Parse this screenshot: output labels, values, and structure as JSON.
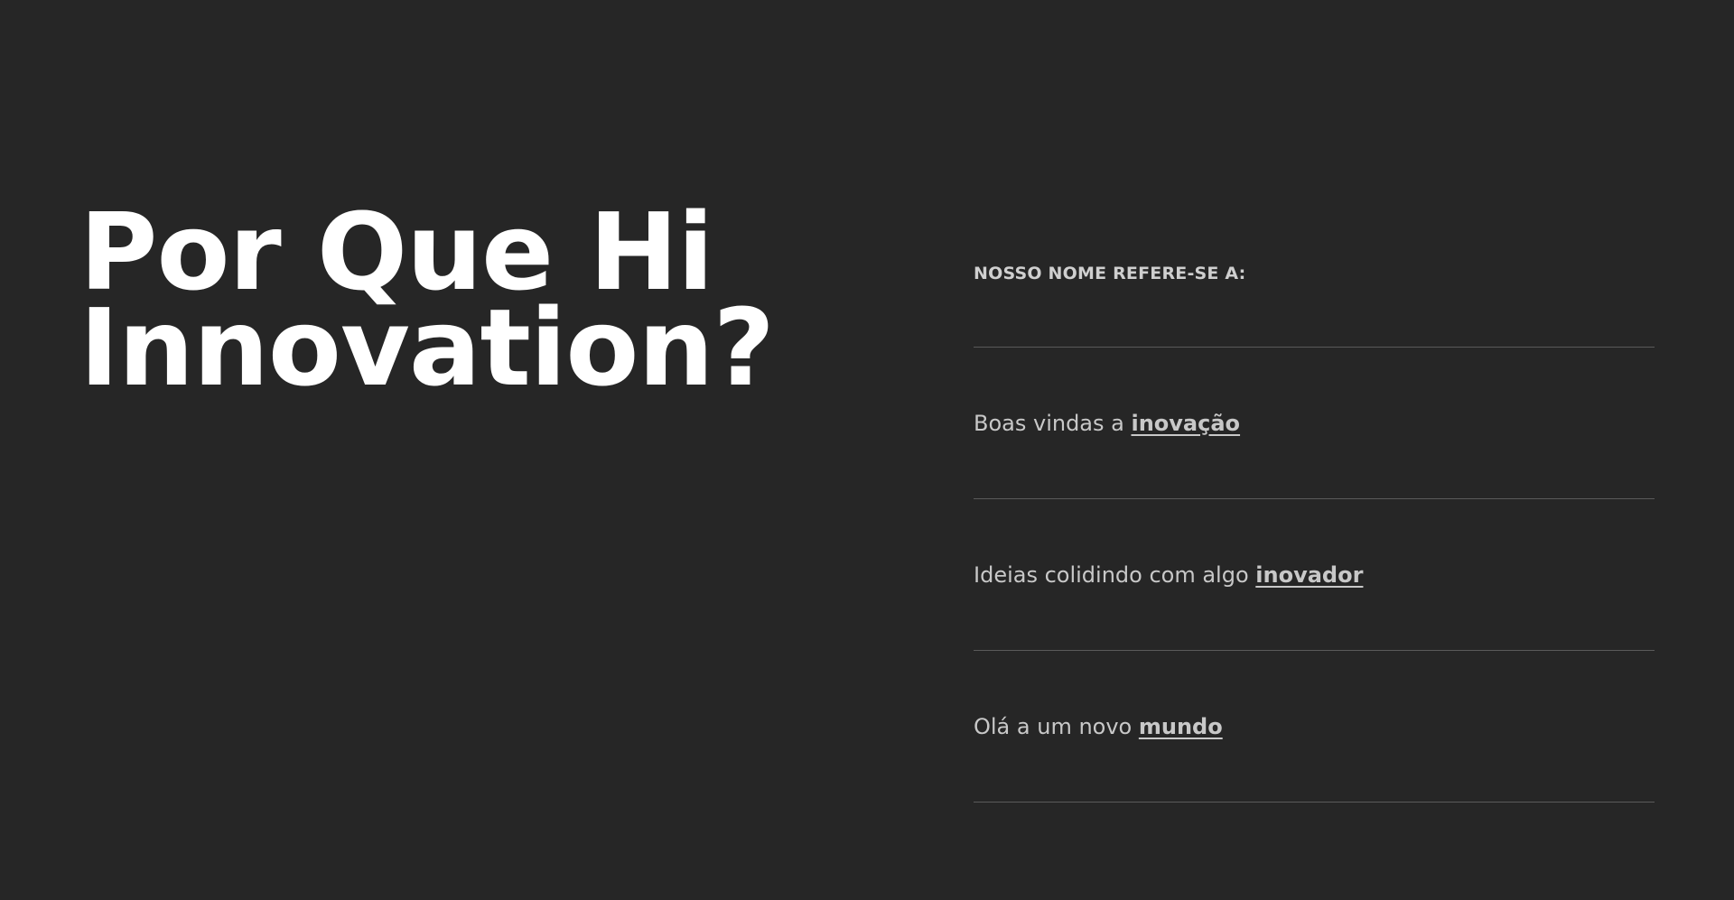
{
  "hero": {
    "title_line1": "Por Que Hi",
    "title_line2": "Innovation?"
  },
  "meaning": {
    "heading": "NOSSO NOME REFERE-SE A:",
    "items": [
      {
        "text": "Boas vindas a ",
        "link": "inovação"
      },
      {
        "text": "Ideias colidindo com algo ",
        "link": "inovador"
      },
      {
        "text": "Olá a um novo ",
        "link": "mundo"
      }
    ]
  },
  "colors": {
    "background": "#262626",
    "title": "#ffffff",
    "body_text": "#c8c8c8",
    "divider": "#5a5a5a"
  }
}
